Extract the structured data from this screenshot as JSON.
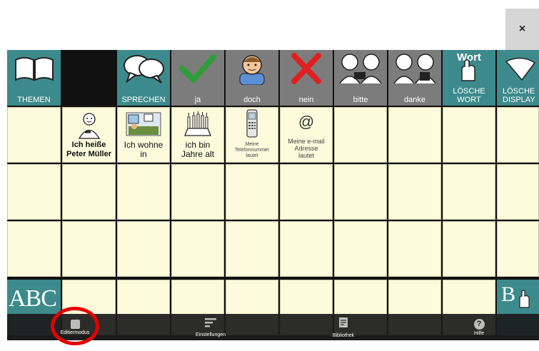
{
  "window": {
    "close_label": "×"
  },
  "top_row": [
    {
      "label": "THEMEN"
    },
    {
      "label": ""
    },
    {
      "label": "SPRECHEN"
    },
    {
      "label": "ja"
    },
    {
      "label": "doch"
    },
    {
      "label": "nein"
    },
    {
      "label": "bitte"
    },
    {
      "label": "danke"
    },
    {
      "label": "LÖSCHE\nWORT",
      "overlay": "Wort"
    },
    {
      "label": "LÖSCHE\nDISPLAY"
    }
  ],
  "phrase_cells": [
    {
      "label": "Ich heiße\nPeter Müller"
    },
    {
      "label": "Ich wohne\nin"
    },
    {
      "label": "ich bin\nJahre alt"
    },
    {
      "label": "Meine\nTelefonnummer\nlautet"
    },
    {
      "label": "Meine e-mail\nAdresse\nlautet"
    }
  ],
  "bottom_left": {
    "label": "ABC"
  },
  "bottom_right": {
    "label": "B"
  },
  "toolbar": {
    "edit_mode": "Editiermodus",
    "settings": "Einstellungen",
    "library": "Bibliothek",
    "help": "Hilfe"
  },
  "colors": {
    "teal": "#3d8a8c",
    "gray": "#7c7c7c",
    "cream": "#fdfbdc",
    "highlight": "#e30000"
  }
}
